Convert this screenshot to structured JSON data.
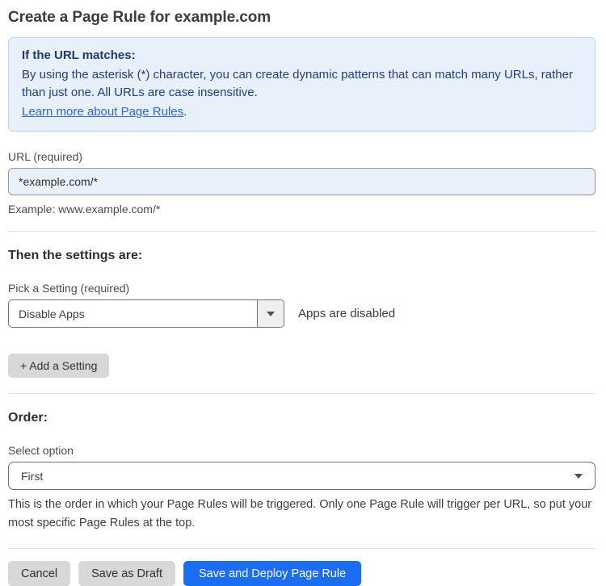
{
  "page": {
    "title": "Create a Page Rule for example.com"
  },
  "info_box": {
    "heading": "If the URL matches:",
    "body": "By using the asterisk (*) character, you can create dynamic patterns that can match many URLs, rather than just one. All URLs are case insensitive.",
    "link_label": "Learn more about Page Rules",
    "link_suffix": "."
  },
  "url_field": {
    "label": "URL (required)",
    "value": "*example.com/*",
    "helper": "Example: www.example.com/*"
  },
  "settings_section": {
    "heading": "Then the settings are:",
    "setting_label": "Pick a Setting (required)",
    "setting_value": "Disable Apps",
    "setting_status": "Apps are disabled",
    "add_setting_label": "+ Add a Setting"
  },
  "order_section": {
    "heading": "Order:",
    "label": "Select option",
    "value": "First",
    "helper": "This is the order in which your Page Rules will be triggered. Only one Page Rule will trigger per URL, so put your most specific Page Rules at the top."
  },
  "footer": {
    "cancel_label": "Cancel",
    "save_draft_label": "Save as Draft",
    "save_deploy_label": "Save and Deploy Page Rule"
  },
  "icons": {
    "setting_dropdown_arrow": "triangle-down",
    "order_dropdown_caret": "triangle-down"
  },
  "colors": {
    "accent_blue": "#1b6ef3",
    "info_box_bg": "#e8f1fb",
    "info_box_border": "#bcd6f2",
    "info_text": "#22407c",
    "link_blue": "#2b66d9",
    "url_input_bg": "#e9f1fc",
    "gray_button_bg": "#d8d8d8"
  }
}
